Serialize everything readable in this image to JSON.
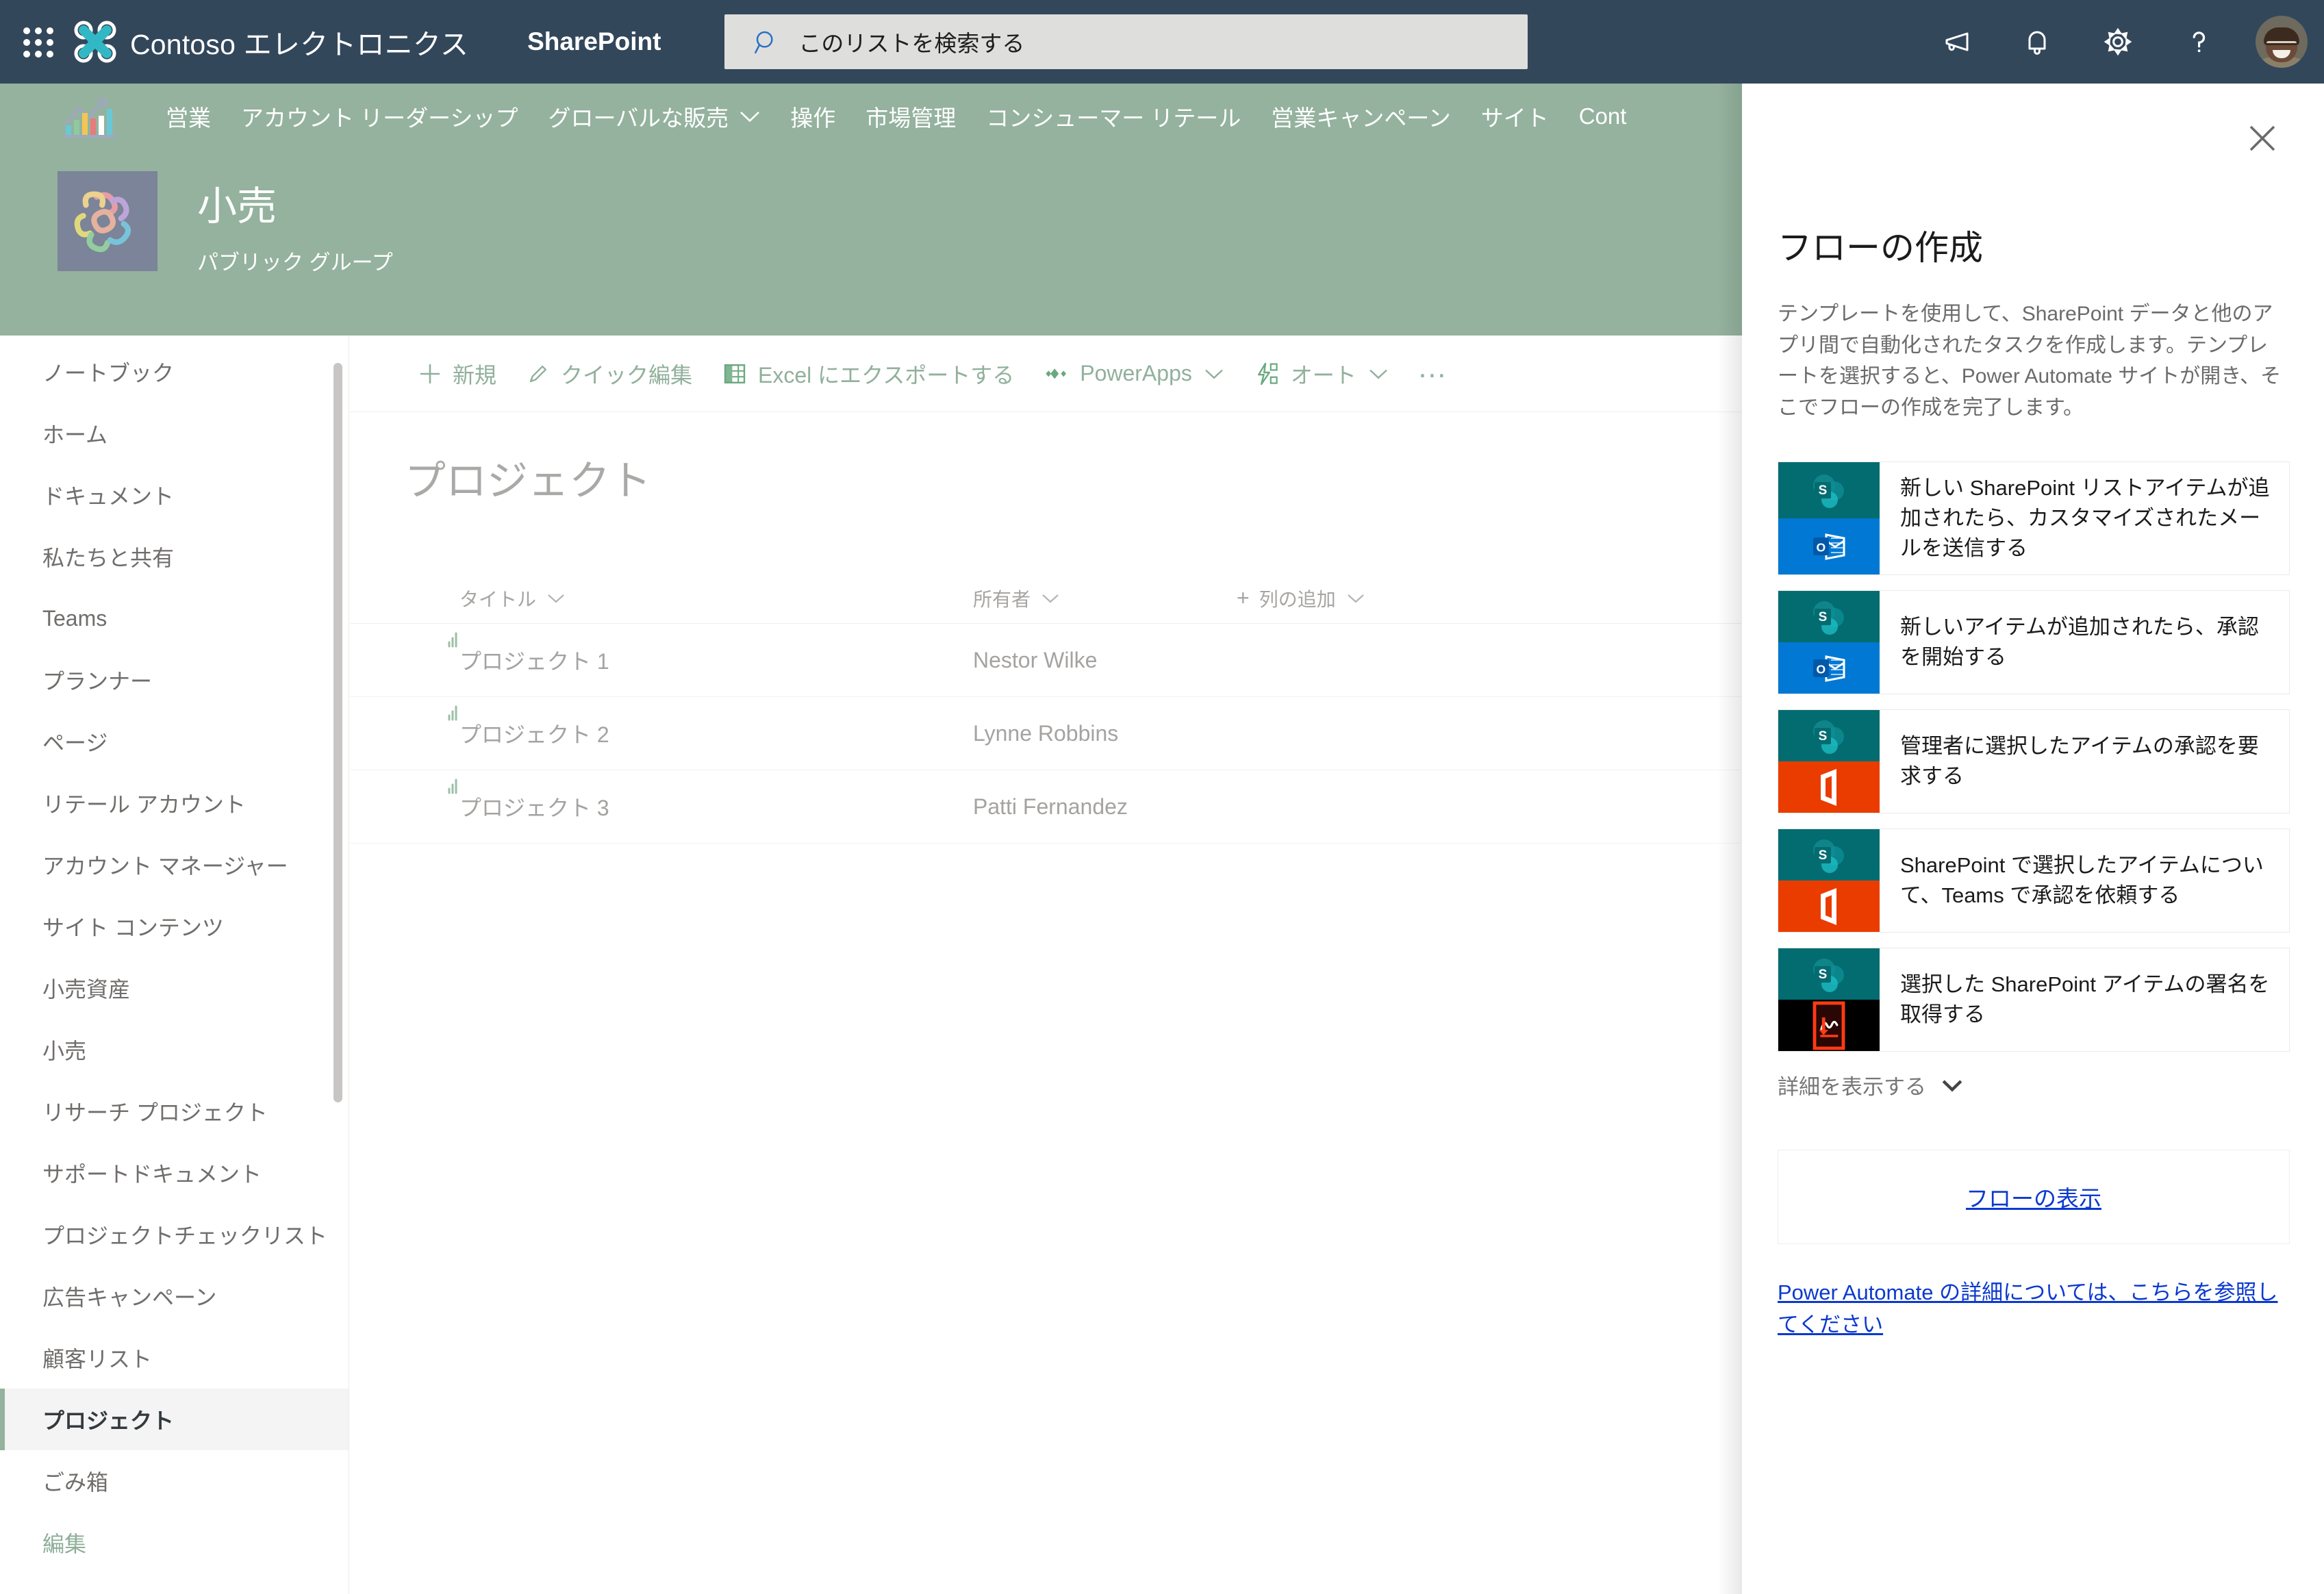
{
  "suite": {
    "waffle_label": "app-launcher",
    "brand_name": "Contoso エレクトロニクス",
    "app_name": "SharePoint",
    "search_placeholder": "このリストを検索する",
    "icons": [
      "megaphone-icon",
      "bell-icon",
      "gear-icon",
      "help-icon",
      "avatar"
    ]
  },
  "topnav": {
    "items": [
      {
        "label": "営業",
        "has_chevron": false
      },
      {
        "label": "アカウント リーダーシップ",
        "has_chevron": false
      },
      {
        "label": "グローバルな販売",
        "has_chevron": true
      },
      {
        "label": "操作",
        "has_chevron": false
      },
      {
        "label": "市場管理",
        "has_chevron": false
      },
      {
        "label": "コンシューマー リテール",
        "has_chevron": false
      },
      {
        "label": "営業キャンペーン",
        "has_chevron": false
      },
      {
        "label": "サイト",
        "has_chevron": false
      },
      {
        "label": "Cont",
        "has_chevron": false
      }
    ]
  },
  "site": {
    "title": "小売",
    "subtitle": "パブリック グループ"
  },
  "sidebar": {
    "items": [
      {
        "label": "ノートブック",
        "selected": false
      },
      {
        "label": "ホーム",
        "selected": false
      },
      {
        "label": "ドキュメント",
        "selected": false
      },
      {
        "label": "私たちと共有",
        "selected": false
      },
      {
        "label": "Teams",
        "selected": false
      },
      {
        "label": "プランナー",
        "selected": false
      },
      {
        "label": "ページ",
        "selected": false
      },
      {
        "label": "リテール アカウント",
        "selected": false
      },
      {
        "label": "アカウント マネージャー",
        "selected": false
      },
      {
        "label": "サイト コンテンツ",
        "selected": false
      },
      {
        "label": "小売資産",
        "selected": false
      },
      {
        "label": "小売",
        "selected": false
      },
      {
        "label": "リサーチ プロジェクト",
        "selected": false
      },
      {
        "label": "サポートドキュメント",
        "selected": false
      },
      {
        "label": "プロジェクトチェックリスト",
        "selected": false
      },
      {
        "label": "広告キャンペーン",
        "selected": false
      },
      {
        "label": "顧客リスト",
        "selected": false
      },
      {
        "label": "プロジェクト",
        "selected": true
      },
      {
        "label": "ごみ箱",
        "selected": false
      }
    ],
    "edit_label": "編集"
  },
  "commandbar": {
    "new_label": "新規",
    "quickedit_label": "クイック編集",
    "export_label": "Excel にエクスポートする",
    "powerapps_label": "PowerApps",
    "automate_label": "オート",
    "more_label": "…"
  },
  "list": {
    "title": "プロジェクト",
    "columns": [
      {
        "label": "タイトル"
      },
      {
        "label": "所有者"
      },
      {
        "label": "列の追加"
      }
    ],
    "rows": [
      {
        "title": "プロジェクト 1",
        "owner": "Nestor Wilke"
      },
      {
        "title": "プロジェクト 2",
        "owner": "Lynne Robbins"
      },
      {
        "title": "プロジェクト 3",
        "owner": "Patti Fernandez"
      }
    ]
  },
  "flow_panel": {
    "close_label": "close-icon",
    "title": "フローの作成",
    "description": "テンプレートを使用して、SharePoint データと他のアプリ間で自動化されたタスクを作成します。テンプレートを選択すると、Power Automate サイトが開き、そこでフローの作成を完了します。",
    "templates": [
      {
        "text": "新しい SharePoint リストアイテムが追加されたら、カスタマイズされたメールを送信する",
        "top_icon": "sharepoint-icon",
        "bottom_icon": "outlook-icon"
      },
      {
        "text": "新しいアイテムが追加されたら、承認を開始する",
        "top_icon": "sharepoint-icon",
        "bottom_icon": "outlook-icon"
      },
      {
        "text": "管理者に選択したアイテムの承認を要求する",
        "top_icon": "sharepoint-icon",
        "bottom_icon": "office365-icon"
      },
      {
        "text": "SharePoint で選択したアイテムについて、Teams で承認を依頼する",
        "top_icon": "sharepoint-icon",
        "bottom_icon": "office365-icon"
      },
      {
        "text": "選択した SharePoint アイテムの署名を取得する",
        "top_icon": "sharepoint-icon",
        "bottom_icon": "adobe-sign-icon"
      }
    ],
    "show_more_label": "詳細を表示する",
    "view_flows_label": "フローの表示",
    "learn_more_label": "Power Automate の詳細については、こちらを参照してください"
  },
  "colors": {
    "suitebar_bg": "#33475b",
    "theme_green": "#94b29e",
    "accent_teal": "#32b8c4",
    "link_blue": "#0b39cf",
    "sharepoint_teal": "#036c70",
    "outlook_blue": "#0078d4",
    "office_orange": "#eb3c00"
  }
}
